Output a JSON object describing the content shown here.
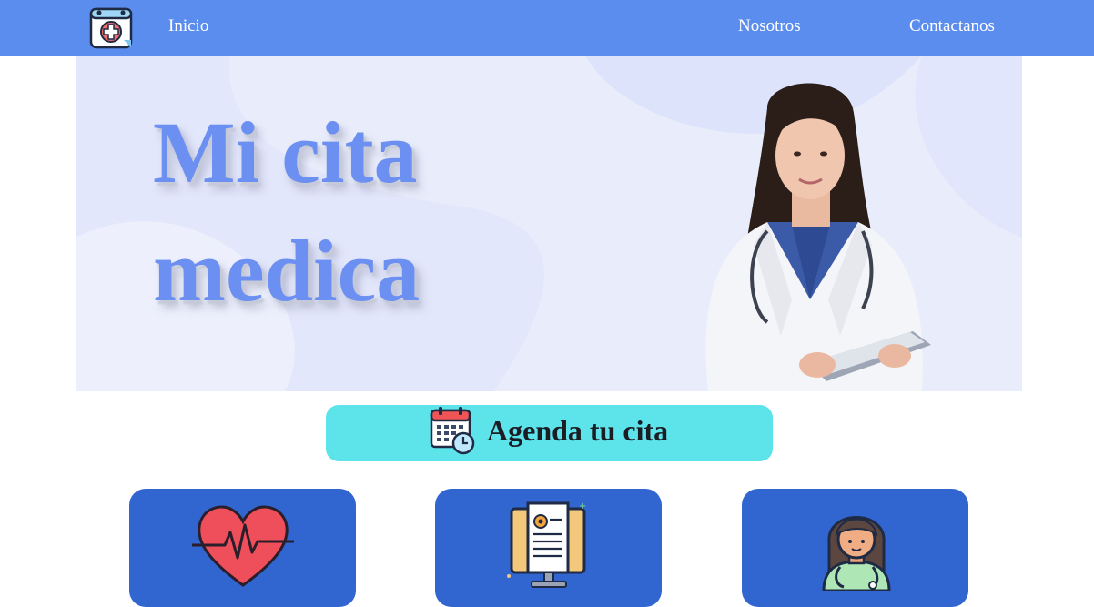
{
  "nav": {
    "links": [
      {
        "label": "Inicio"
      },
      {
        "label": "Nosotros"
      },
      {
        "label": "Contactanos"
      }
    ]
  },
  "hero": {
    "title": "Mi cita medica"
  },
  "cta": {
    "label": "Agenda tu cita"
  },
  "cards": [
    {
      "icon": "heartbeat-icon"
    },
    {
      "icon": "medical-report-monitor-icon"
    },
    {
      "icon": "doctor-avatar-icon"
    }
  ],
  "colors": {
    "navbar": "#5b8def",
    "hero_bg": "#e9edfb",
    "title": "#6c8ff2",
    "cta": "#5de3ea",
    "card": "#3166d0"
  }
}
